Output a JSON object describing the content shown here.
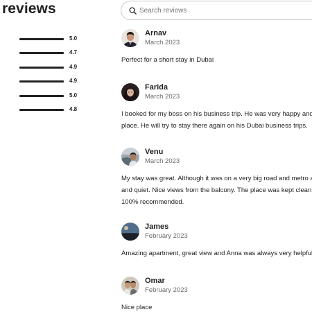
{
  "header": {
    "title": "reviews"
  },
  "search": {
    "placeholder": "Search reviews"
  },
  "ratings": [
    {
      "value": "5.0"
    },
    {
      "value": "4.7"
    },
    {
      "value": "4.9"
    },
    {
      "value": "4.9"
    },
    {
      "value": "5.0"
    },
    {
      "value": "4.8"
    }
  ],
  "reviews": [
    {
      "name": "Arnav",
      "date": "March 2023",
      "lines": [
        "Perfect for a short stay in Dubai"
      ]
    },
    {
      "name": "Farida",
      "date": "March 2023",
      "lines": [
        "I booked for my boss on his business trip. He was very happy and sa",
        "place. He will try to stay there again on his Dubai business trips."
      ]
    },
    {
      "name": "Venu",
      "date": "March 2023",
      "lines": [
        "My stay was great. Although it was on a very big road and metro are",
        "and quiet. Nice views from the balcony. The place was kept clean w",
        "100% recommended."
      ]
    },
    {
      "name": "James",
      "date": "February 2023",
      "lines": [
        "Amazing apartment, great view and Anna was always very helpful. ‘"
      ]
    },
    {
      "name": "Omar",
      "date": "February 2023",
      "lines": [
        "Nice place"
      ]
    }
  ]
}
